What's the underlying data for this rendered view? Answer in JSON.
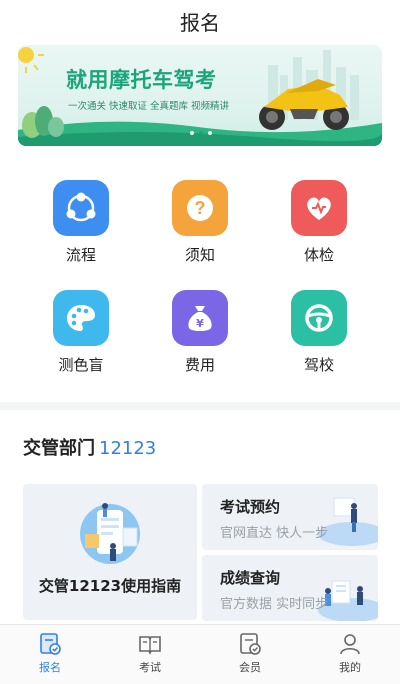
{
  "header": {
    "title": "报名"
  },
  "banner": {
    "headline": "就用摩托车驾考",
    "subtitle": "一次通关 快速取证  全真题库 视频精讲",
    "page_count": 3,
    "active_page": 2
  },
  "grid": {
    "items": [
      {
        "label": "流程",
        "icon": "flow-icon",
        "color": "#3d8ef0"
      },
      {
        "label": "须知",
        "icon": "question-icon",
        "color": "#f4a43a"
      },
      {
        "label": "体检",
        "icon": "heart-icon",
        "color": "#ef5a5a"
      },
      {
        "label": "测色盲",
        "icon": "palette-icon",
        "color": "#3fb8ee"
      },
      {
        "label": "费用",
        "icon": "money-bag-icon",
        "color": "#7b67e6"
      },
      {
        "label": "驾校",
        "icon": "steering-wheel-icon",
        "color": "#2bbfa4"
      }
    ]
  },
  "section": {
    "title": "交管部门",
    "number": "12123"
  },
  "cards": {
    "guide": {
      "label": "交管12123使用指南"
    },
    "booking": {
      "title": "考试预约",
      "subtitle": "官网直达 快人一步"
    },
    "results": {
      "title": "成绩查询",
      "subtitle": "官方数据 实时同步"
    }
  },
  "tabbar": {
    "items": [
      {
        "label": "报名",
        "icon": "signup-icon",
        "active": true
      },
      {
        "label": "考试",
        "icon": "book-icon",
        "active": false
      },
      {
        "label": "会员",
        "icon": "member-icon",
        "active": false
      },
      {
        "label": "我的",
        "icon": "user-icon",
        "active": false
      }
    ]
  },
  "colors": {
    "accent": "#2f80ed",
    "banner_green": "#1aa57a"
  }
}
